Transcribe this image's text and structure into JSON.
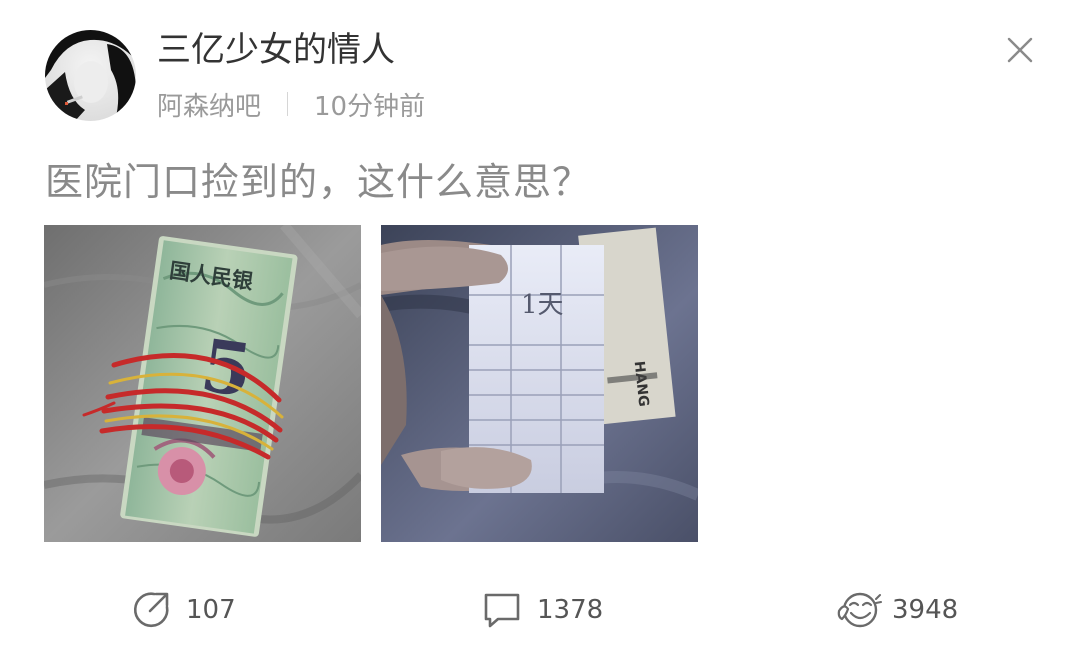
{
  "header": {
    "username": "三亿少女的情人",
    "source": "阿森纳吧",
    "time": "10分钟前",
    "close_icon": "close-icon",
    "avatar_icon": "avatar-silhouette"
  },
  "post": {
    "text": "医院门口捡到的，这什么意思？",
    "images": [
      {
        "name": "folded-5-yuan-banknote-tied-with-red-string"
      },
      {
        "name": "folded-paper-note-held-in-hand"
      }
    ]
  },
  "banknote": {
    "printed_text": "国人民银",
    "denomination": "5"
  },
  "note": {
    "handwritten_text": "1天",
    "tag_text": "HANG"
  },
  "actions": {
    "repost": {
      "icon": "repost-icon",
      "count": "107"
    },
    "comment": {
      "icon": "comment-icon",
      "count": "1378"
    },
    "like": {
      "icon": "like-icon",
      "count": "3948"
    }
  },
  "colors": {
    "username": "#333333",
    "meta": "#9a9a9a",
    "post_text": "#8a8a8a",
    "action_text": "#555555",
    "icon_stroke": "#6a6a6a"
  }
}
